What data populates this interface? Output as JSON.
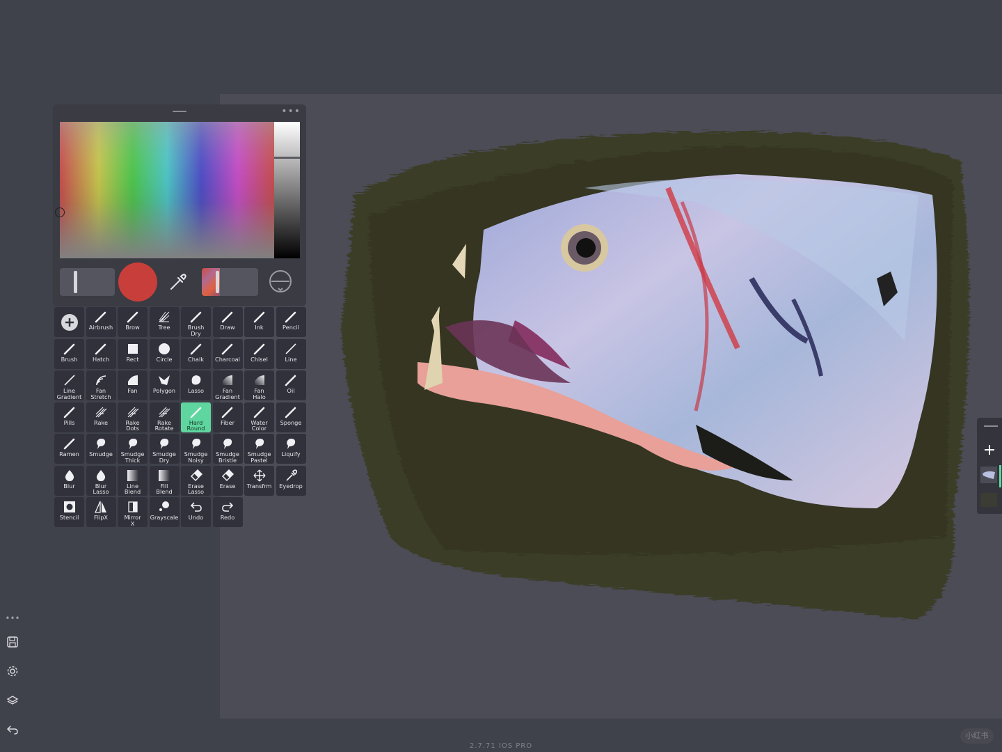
{
  "app": {
    "version": "2.7.71 IOS PRO",
    "watermark": "小红书"
  },
  "color_panel": {
    "grab_handle": "—",
    "more_menu": "•••",
    "current_color": "#c83e3a",
    "eyedropper_icon": "eyedropper-icon"
  },
  "tools": [
    {
      "label": "",
      "icon": "add"
    },
    {
      "label": "Airbrush",
      "icon": "pen"
    },
    {
      "label": "Brow",
      "icon": "pen"
    },
    {
      "label": "Tree",
      "icon": "tree"
    },
    {
      "label": "Brush\nDry",
      "icon": "pen"
    },
    {
      "label": "Draw",
      "icon": "pen"
    },
    {
      "label": "Ink",
      "icon": "pen"
    },
    {
      "label": "Pencil",
      "icon": "pen"
    },
    {
      "label": "Brush",
      "icon": "pen"
    },
    {
      "label": "Hatch",
      "icon": "pen"
    },
    {
      "label": "Rect",
      "icon": "rect"
    },
    {
      "label": "Circle",
      "icon": "circle"
    },
    {
      "label": "Chalk",
      "icon": "pen"
    },
    {
      "label": "Charcoal",
      "icon": "pen"
    },
    {
      "label": "Chisel",
      "icon": "pen"
    },
    {
      "label": "Line",
      "icon": "line"
    },
    {
      "label": "Line\nGradient",
      "icon": "line"
    },
    {
      "label": "Fan\nStretch",
      "icon": "fan"
    },
    {
      "label": "Fan",
      "icon": "fanfill"
    },
    {
      "label": "Polygon",
      "icon": "polygon"
    },
    {
      "label": "Lasso",
      "icon": "lasso"
    },
    {
      "label": "Fan\nGradient",
      "icon": "fangrad"
    },
    {
      "label": "Fan\nHalo",
      "icon": "fangrad"
    },
    {
      "label": "Oil",
      "icon": "pen"
    },
    {
      "label": "Pills",
      "icon": "pen"
    },
    {
      "label": "Rake",
      "icon": "rake"
    },
    {
      "label": "Rake\nDots",
      "icon": "rake"
    },
    {
      "label": "Rake\nRotate",
      "icon": "rake"
    },
    {
      "label": "Hard\nRound",
      "icon": "pen",
      "active": true
    },
    {
      "label": "Fiber",
      "icon": "pen"
    },
    {
      "label": "Water\nColor",
      "icon": "pen"
    },
    {
      "label": "Sponge",
      "icon": "pen"
    },
    {
      "label": "Ramen",
      "icon": "pen"
    },
    {
      "label": "Smudge",
      "icon": "smudge"
    },
    {
      "label": "Smudge\nThick",
      "icon": "smudge"
    },
    {
      "label": "Smudge\nDry",
      "icon": "smudge"
    },
    {
      "label": "Smudge\nNoisy",
      "icon": "smudge"
    },
    {
      "label": "Smudge\nBristle",
      "icon": "smudge"
    },
    {
      "label": "Smudge\nPastel",
      "icon": "smudge"
    },
    {
      "label": "Liquify",
      "icon": "smudge"
    },
    {
      "label": "Blur",
      "icon": "drop"
    },
    {
      "label": "Blur\nLasso",
      "icon": "drop"
    },
    {
      "label": "Line\nBlend",
      "icon": "grad"
    },
    {
      "label": "Fill\nBlend",
      "icon": "grad"
    },
    {
      "label": "Erase\nLasso",
      "icon": "eraser"
    },
    {
      "label": "Erase",
      "icon": "eraser"
    },
    {
      "label": "Transfrm",
      "icon": "move"
    },
    {
      "label": "Eyedrop",
      "icon": "eyedrop"
    },
    {
      "label": "Stencil",
      "icon": "stencil"
    },
    {
      "label": "FlipX",
      "icon": "flip"
    },
    {
      "label": "Mirror\nX",
      "icon": "mirror"
    },
    {
      "label": "Grayscale",
      "icon": "dots"
    },
    {
      "label": "Undo",
      "icon": "undo"
    },
    {
      "label": "Redo",
      "icon": "redo"
    }
  ],
  "left_toolbar": {
    "more": "•••",
    "items": [
      {
        "name": "save-icon"
      },
      {
        "name": "settings-gear-icon"
      },
      {
        "name": "layers-icon"
      },
      {
        "name": "back-icon"
      }
    ]
  }
}
